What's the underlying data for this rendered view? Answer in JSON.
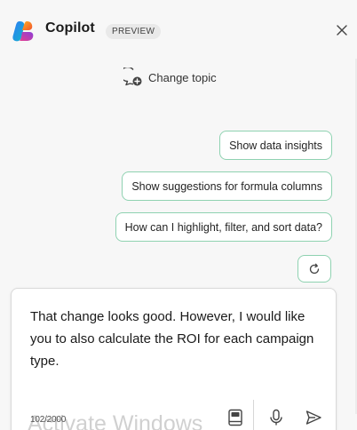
{
  "header": {
    "title": "Copilot",
    "badge": "PREVIEW",
    "close_icon": "close-icon"
  },
  "change_topic": {
    "label": "Change topic",
    "icon": "chat-add-icon"
  },
  "suggestions": [
    "Show data insights",
    "Show suggestions for formula columns",
    "How can I highlight, filter, and sort data?"
  ],
  "refresh_icon": "refresh-icon",
  "composer": {
    "text": "That change looks good. However, I would like you to also calculate the ROI for each campaign type.",
    "char_count": "102/2000",
    "icons": [
      "prompt-guide-icon",
      "microphone-icon",
      "send-icon"
    ]
  },
  "watermark": "Activate Windows",
  "colors": {
    "chip_border": "#8fd2b1",
    "background": "#f7f7f7"
  }
}
